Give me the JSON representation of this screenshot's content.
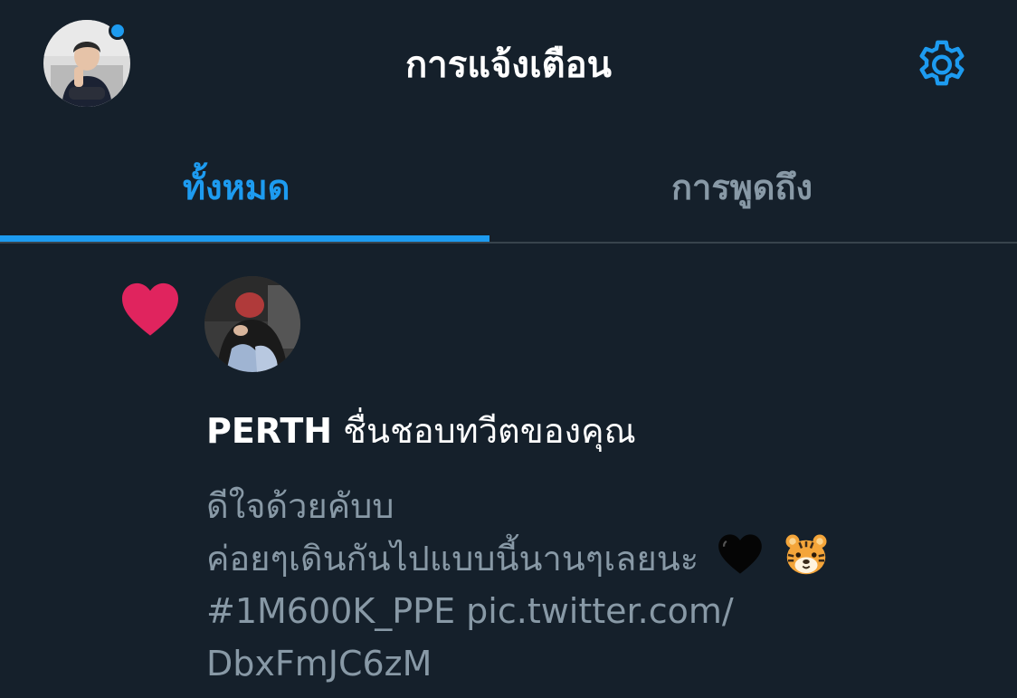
{
  "header": {
    "title": "การแจ้งเตือน",
    "avatar_icon": "profile-avatar",
    "settings_icon": "gear-icon",
    "unread_dot_color": "#1d9bf0"
  },
  "tabs": [
    {
      "label": "ทั้งหมด",
      "active": true
    },
    {
      "label": "การพูดถึง",
      "active": false
    }
  ],
  "notification": {
    "type_icon": "heart-icon",
    "icon_color": "#e0245e",
    "user_name": "PERTH",
    "action_text": " ชื่นชอบทวีตของคุณ",
    "tweet_lines": [
      "ดีใจด้วยคับบ",
      "ค่อยๆเดินกันไปแบบนี้นานๆเลยนะ"
    ],
    "emojis": [
      "black-heart-emoji",
      "tiger-face-emoji"
    ],
    "hashtag_line": "#1M600K_PPE pic.twitter.com/",
    "link_tail": "DbxFmJC6zM"
  },
  "colors": {
    "background": "#15202b",
    "accent": "#1d9bf0",
    "secondary_text": "#8899a6"
  }
}
